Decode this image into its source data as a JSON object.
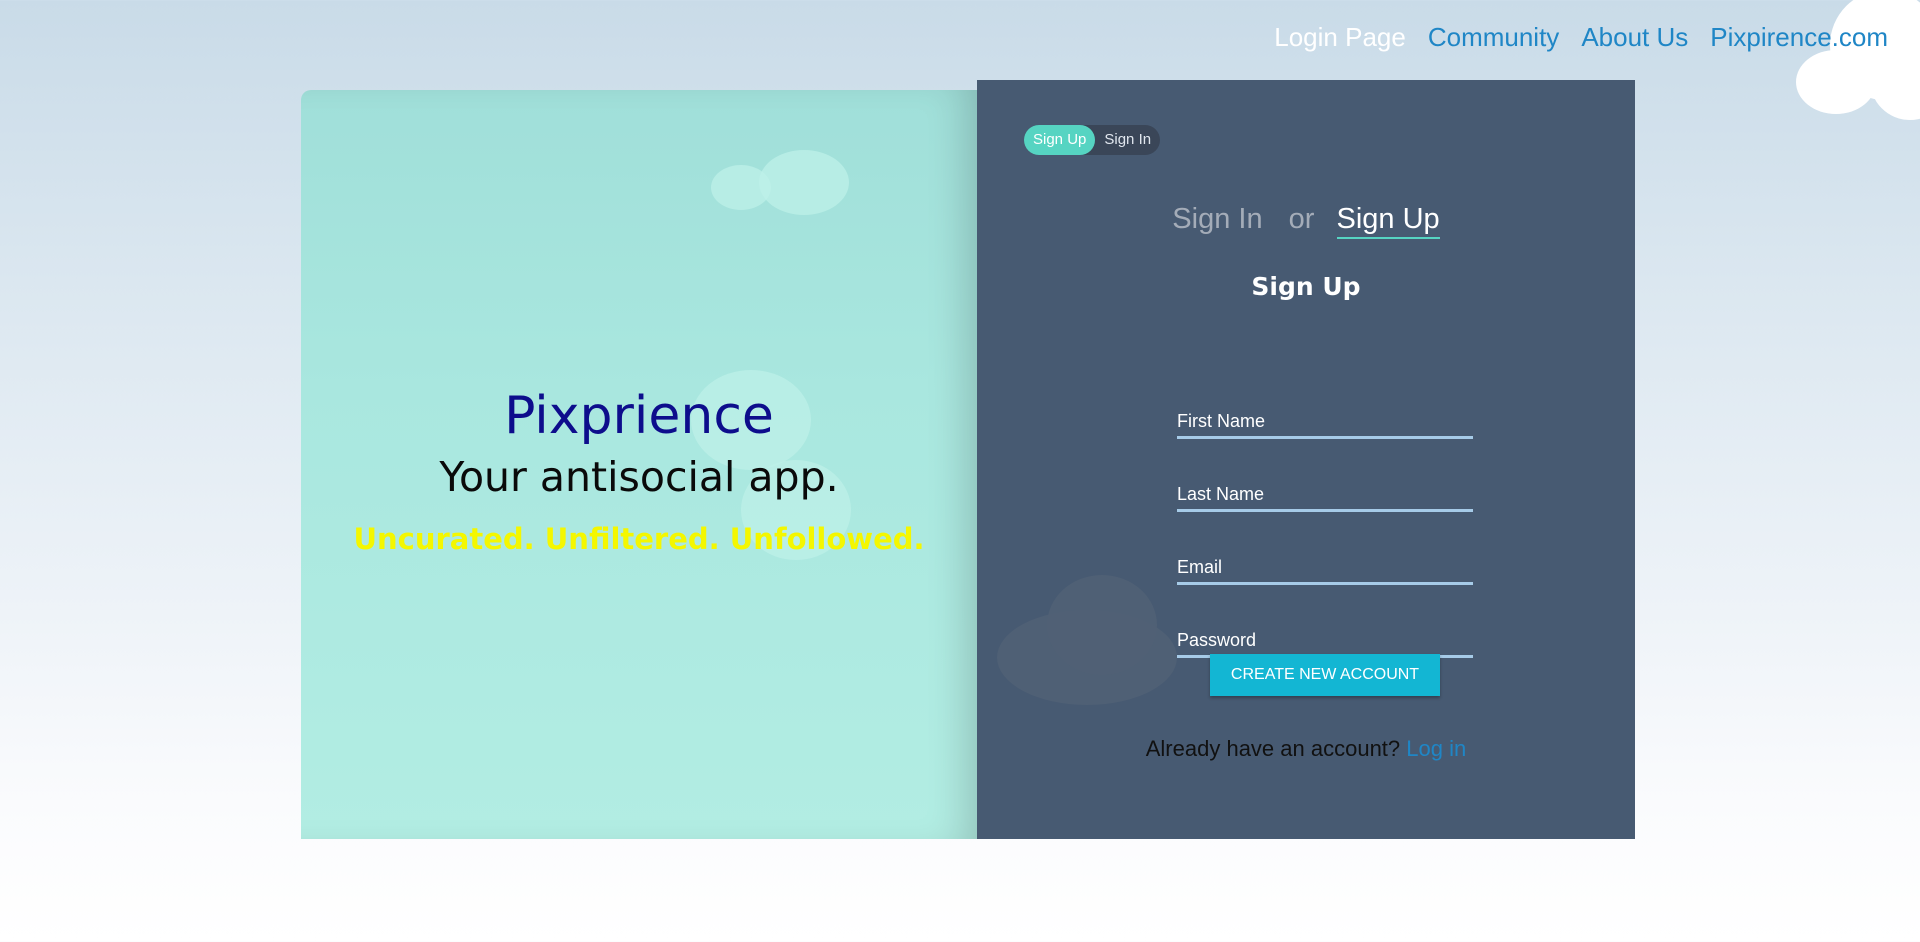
{
  "nav": {
    "items": [
      {
        "label": "Login Page",
        "active": true
      },
      {
        "label": "Community",
        "active": false
      },
      {
        "label": "About Us",
        "active": false
      },
      {
        "label": "Pixpirence.com",
        "active": false
      }
    ]
  },
  "hero": {
    "brand": "Pixprience",
    "tagline": "Your antisocial app.",
    "slogan": "Uncurated. Unfiltered. Unfollowed."
  },
  "form": {
    "toggle": {
      "signup_label": "Sign Up",
      "signin_label": "Sign In",
      "selected": "Sign Up"
    },
    "mode_switch": {
      "signin": "Sign In",
      "or": "or",
      "signup": "Sign Up"
    },
    "title": "Sign Up",
    "fields": {
      "first_name": {
        "placeholder": "First Name",
        "value": ""
      },
      "last_name": {
        "placeholder": "Last Name",
        "value": ""
      },
      "email": {
        "placeholder": "Email",
        "value": ""
      },
      "password": {
        "placeholder": "Password",
        "value": ""
      }
    },
    "submit_label": "CREATE NEW ACCOUNT",
    "footer": {
      "prompt": "Already have an account?",
      "link": "Log in"
    }
  },
  "colors": {
    "accent": "#56d4c2",
    "button": "#13b6d3",
    "form_bg": "#475a72",
    "hero_bg": "#a9e7df",
    "brand": "#0d0d8c",
    "slogan": "#f4f700",
    "link": "#1f86c6"
  }
}
